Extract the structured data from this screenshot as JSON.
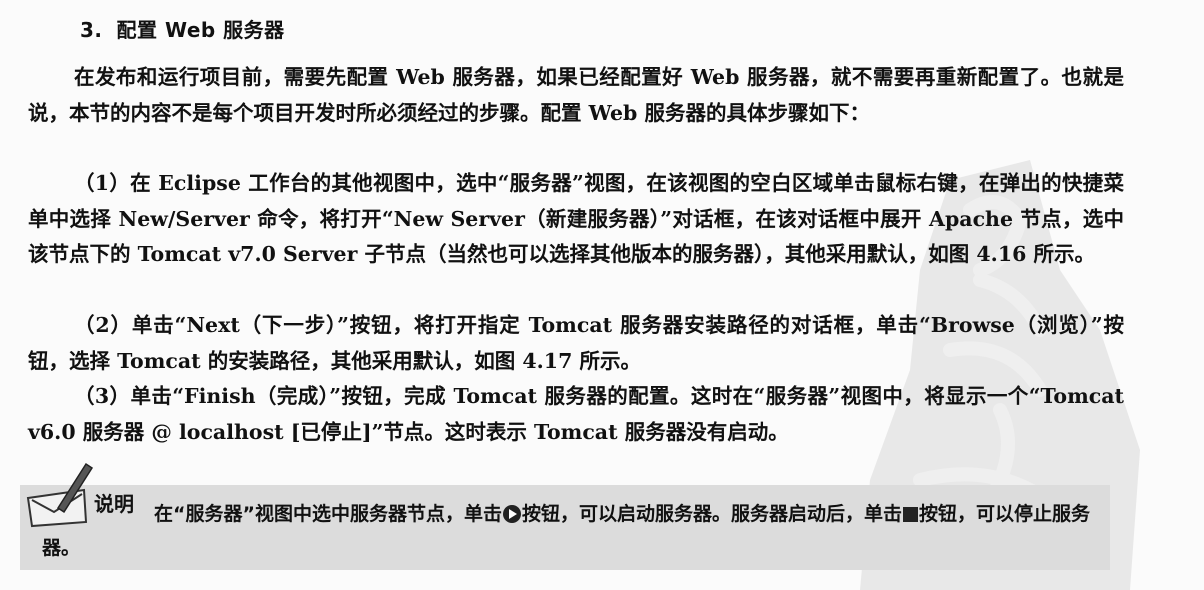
{
  "section": {
    "number": "3.",
    "title": "配置 Web 服务器"
  },
  "paragraphs": {
    "intro": "在发布和运行项目前，需要先配置 Web 服务器，如果已经配置好 Web 服务器，就不需要再重新配置了。也就是说，本节的内容不是每个项目开发时所必须经过的步骤。配置 Web 服务器的具体步骤如下：",
    "step1": "（1）在 Eclipse 工作台的其他视图中，选中“服务器”视图，在该视图的空白区域单击鼠标右键，在弹出的快捷菜单中选择 New/Server 命令，将打开“New Server（新建服务器）”对话框，在该对话框中展开 Apache 节点，选中该节点下的 Tomcat v7.0 Server 子节点（当然也可以选择其他版本的服务器），其他采用默认，如图 4.16 所示。",
    "step2": "（2）单击“Next（下一步）”按钮，将打开指定 Tomcat 服务器安装路径的对话框，单击“Browse（浏览）”按钮，选择 Tomcat 的安装路径，其他采用默认，如图 4.17 所示。",
    "step3": "（3）单击“Finish（完成）”按钮，完成 Tomcat 服务器的配置。这时在“服务器”视图中，将显示一个“Tomcat v6.0 服务器 @ localhost [已停止]”节点。这时表示 Tomcat 服务器没有启动。"
  },
  "note": {
    "label": "说明",
    "text_part1": "在“服务器”视图中选中服务器节点，单击",
    "text_part2": "按钮，可以启动服务器。服务器启动后，单击",
    "text_part3": "按钮，可以停止服务器。",
    "start_icon": "play-circle-icon",
    "stop_icon": "stop-square-icon"
  }
}
